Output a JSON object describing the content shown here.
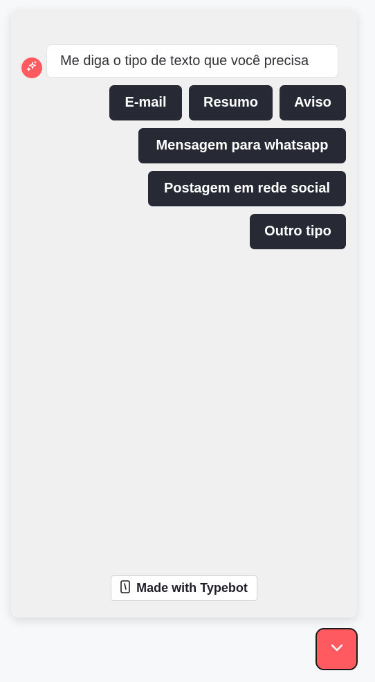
{
  "bot": {
    "message": "Me diga o tipo de texto que você precisa",
    "avatar_icon": "sparkles-icon",
    "avatar_color": "#ff5a5f"
  },
  "choices": {
    "email": "E-mail",
    "resumo": "Resumo",
    "aviso": "Aviso",
    "whatsapp": "Mensagem para whatsapp",
    "social": "Postagem em rede social",
    "outro": "Outro tipo"
  },
  "branding": {
    "label": "Made with Typebot",
    "icon": "typebot-logo-icon"
  },
  "toggle": {
    "icon": "chevron-down-icon",
    "color": "#ff5a5f"
  },
  "colors": {
    "button_bg": "#272934",
    "window_bg": "#f0f0f0"
  }
}
